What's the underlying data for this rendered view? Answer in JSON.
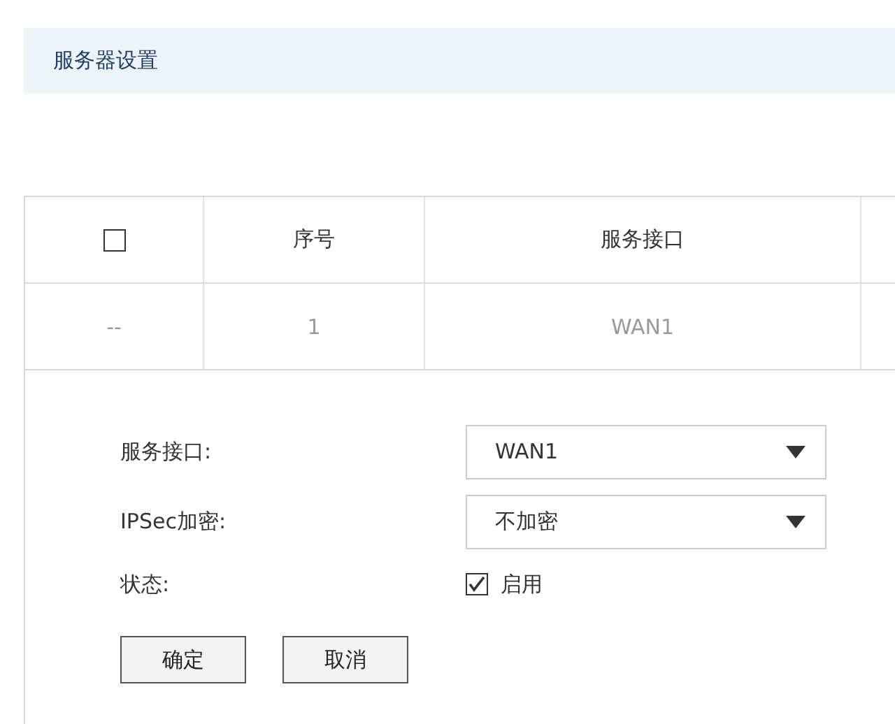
{
  "header": {
    "title": "服务器设置"
  },
  "table": {
    "columns": [
      {
        "kind": "checkbox",
        "checked": false
      },
      {
        "kind": "text",
        "label": "序号"
      },
      {
        "kind": "text",
        "label": "服务接口"
      }
    ],
    "rows": [
      {
        "cells": [
          "--",
          "1",
          "WAN1"
        ]
      }
    ]
  },
  "form": {
    "fields": [
      {
        "kind": "select",
        "label": "服务接口:",
        "value": "WAN1"
      },
      {
        "kind": "select",
        "label": "IPSec加密:",
        "value": "不加密"
      },
      {
        "kind": "checkbox",
        "label": "状态:",
        "option": "启用",
        "checked": true
      }
    ],
    "buttons": [
      "确定",
      "取消"
    ]
  }
}
